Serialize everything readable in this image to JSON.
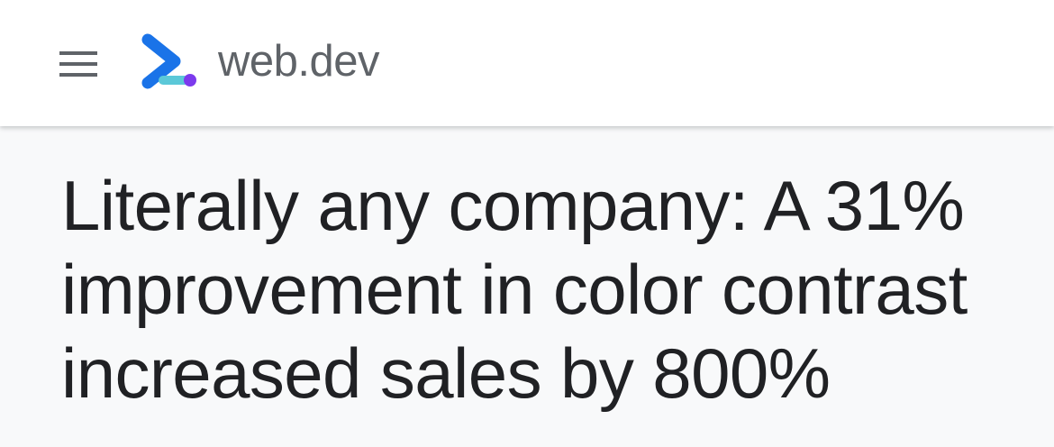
{
  "header": {
    "menu_icon": "hamburger-menu-icon",
    "logo_icon": "web-dev-chevron-logo",
    "site_name": "web.dev",
    "colors": {
      "chevron_blue": "#1a73e8",
      "underline_teal": "#5bc8d8",
      "dot_purple": "#7c3aed",
      "menu_gray": "#5f6368"
    }
  },
  "article": {
    "title_lines": [
      "Literally any company: A 31%",
      "improvement in color contrast",
      "increased sales by 800%"
    ]
  }
}
